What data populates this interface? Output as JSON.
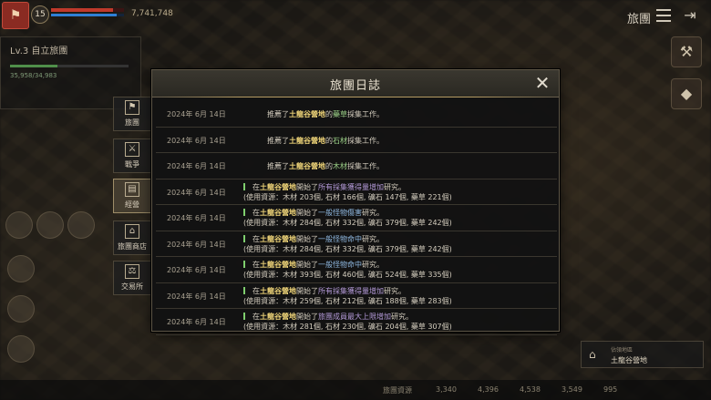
{
  "hud": {
    "player_level": "15",
    "gold": "7,741,748",
    "top_title": "旅團",
    "hp_ratio": 0.85,
    "mp_ratio": 0.9
  },
  "guild_panel": {
    "name": "Lv.3 自立旅團",
    "exp_text": "35,958/34,983"
  },
  "tabs": [
    {
      "label": "旅團",
      "icon": "banner-icon",
      "active": false
    },
    {
      "label": "戰爭",
      "icon": "crossed-swords-icon",
      "active": false
    },
    {
      "label": "經營",
      "icon": "ledger-icon",
      "active": true
    },
    {
      "label": "旅團商店",
      "icon": "shop-icon",
      "active": false
    },
    {
      "label": "交易所",
      "icon": "scales-icon",
      "active": false
    }
  ],
  "dialog": {
    "title": "旅團日誌",
    "close_label": "✕"
  },
  "log_entries": [
    {
      "date": "2024年 6月 14日",
      "line1_pre": "推薦了",
      "place": "土龍谷營地",
      "mid": "的",
      "item": "藥草",
      "line1_post": "採集工作。"
    },
    {
      "date": "2024年 6月 14日",
      "line1_pre": "推薦了",
      "place": "土龍谷營地",
      "mid": "的",
      "item": "石材",
      "line1_post": "採集工作。"
    },
    {
      "date": "2024年 6月 14日",
      "line1_pre": "推薦了",
      "place": "土龍谷營地",
      "mid": "的",
      "item": "木材",
      "line1_post": "採集工作。"
    },
    {
      "date": "2024年 6月 14日",
      "line1_pre": "在",
      "place": "土龍谷營地",
      "mid": "開始了",
      "research": "所有採集獲得量增加",
      "line1_post": "研究。",
      "line2": "(使用資源：木材 203個, 石材 166個, 礦石 147個, 藥草 221個)"
    },
    {
      "date": "2024年 6月 14日",
      "line1_pre": "在",
      "place": "土龍谷營地",
      "mid": "開始了",
      "research": "一般怪物傷害",
      "line1_post": "研究。",
      "line2": "(使用資源：木材 284個, 石材 332個, 礦石 379個, 藥草 242個)"
    },
    {
      "date": "2024年 6月 14日",
      "line1_pre": "在",
      "place": "土龍谷營地",
      "mid": "開始了",
      "research": "一般怪物命中",
      "line1_post": "研究。",
      "line2": "(使用資源：木材 284個, 石材 332個, 礦石 379個, 藥草 242個)"
    },
    {
      "date": "2024年 6月 14日",
      "line1_pre": "在",
      "place": "土龍谷營地",
      "mid": "開始了",
      "research": "一般怪物命中",
      "line1_post": "研究。",
      "line2": "(使用資源：木材 393個, 石材 460個, 礦石 524個, 藥草 335個)"
    },
    {
      "date": "2024年 6月 14日",
      "line1_pre": "在",
      "place": "土龍谷營地",
      "mid": "開始了",
      "research": "所有採集獲得量增加",
      "line1_post": "研究。",
      "line2": "(使用資源：木材 259個, 石材 212個, 礦石 188個, 藥草 283個)"
    },
    {
      "date": "2024年 6月 14日",
      "line1_pre": "在",
      "place": "土龍谷營地",
      "mid": "開始了",
      "research": "旅團成員最大上限增加",
      "line1_post": "研究。",
      "line2": "(使用資源：木材 281個, 石材 230個, 礦石 204個, 藥草 307個)"
    }
  ],
  "territory": {
    "sub": "佔領地區",
    "name": "土龍谷營地"
  },
  "bottom_bar": {
    "label": "旅團資源",
    "res1": "3,340",
    "res2": "4,396",
    "res3": "4,538",
    "res4": "3,549",
    "res5": "995"
  },
  "colors": {
    "highlight_place": "#f2d77a",
    "highlight_item": "#9fd48a",
    "research_purple": "#b49ad8",
    "research_blue": "#8fb8e0"
  }
}
